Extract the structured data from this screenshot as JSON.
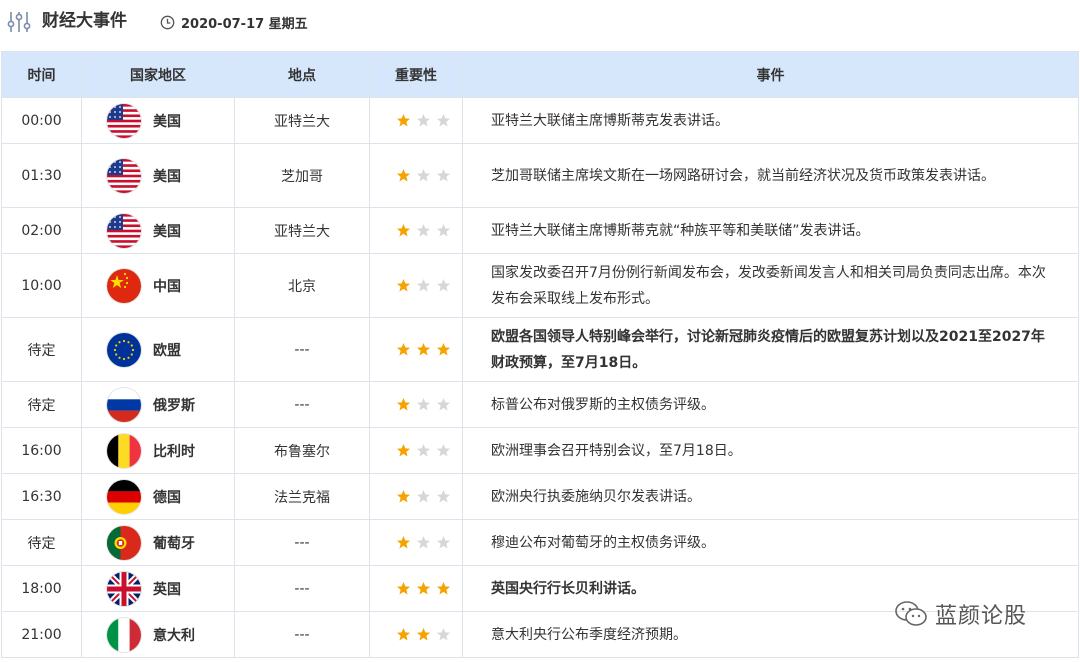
{
  "header": {
    "title": "财经大事件",
    "date": "2020-07-17 星期五",
    "icons": {
      "title_icon": "sliders-icon",
      "date_icon": "clock-icon"
    }
  },
  "table": {
    "columns": [
      "时间",
      "国家地区",
      "地点",
      "重要性",
      "事件"
    ],
    "rows": [
      {
        "time": "00:00",
        "country": "美国",
        "flag": "us",
        "location": "亚特兰大",
        "importance": 1,
        "event": "亚特兰大联储主席博斯蒂克发表讲话。",
        "important": false
      },
      {
        "time": "01:30",
        "country": "美国",
        "flag": "us",
        "location": "芝加哥",
        "importance": 1,
        "event": "芝加哥联储主席埃文斯在一场网路研讨会，就当前经济状况及货币政策发表讲话。",
        "important": false
      },
      {
        "time": "02:00",
        "country": "美国",
        "flag": "us",
        "location": "亚特兰大",
        "importance": 1,
        "event": "亚特兰大联储主席博斯蒂克就“种族平等和美联储”发表讲话。",
        "important": false
      },
      {
        "time": "10:00",
        "country": "中国",
        "flag": "cn",
        "location": "北京",
        "importance": 1,
        "event": "国家发改委召开7月份例行新闻发布会，发改委新闻发言人和相关司局负责同志出席。本次发布会采取线上发布形式。",
        "important": false
      },
      {
        "time": "待定",
        "country": "欧盟",
        "flag": "eu",
        "location": "---",
        "importance": 3,
        "event": "欧盟各国领导人特别峰会举行，讨论新冠肺炎疫情后的欧盟复苏计划以及2021至2027年财政预算，至7月18日。",
        "important": true
      },
      {
        "time": "待定",
        "country": "俄罗斯",
        "flag": "ru",
        "location": "---",
        "importance": 1,
        "event": "标普公布对俄罗斯的主权债务评级。",
        "important": false
      },
      {
        "time": "16:00",
        "country": "比利时",
        "flag": "be",
        "location": "布鲁塞尔",
        "importance": 1,
        "event": "欧洲理事会召开特别会议，至7月18日。",
        "important": false
      },
      {
        "time": "16:30",
        "country": "德国",
        "flag": "de",
        "location": "法兰克福",
        "importance": 1,
        "event": "欧洲央行执委施纳贝尔发表讲话。",
        "important": false
      },
      {
        "time": "待定",
        "country": "葡萄牙",
        "flag": "pt",
        "location": "---",
        "importance": 1,
        "event": "穆迪公布对葡萄牙的主权债务评级。",
        "important": false
      },
      {
        "time": "18:00",
        "country": "英国",
        "flag": "gb",
        "location": "---",
        "importance": 3,
        "event": "英国央行行长贝利讲话。",
        "important": true
      },
      {
        "time": "21:00",
        "country": "意大利",
        "flag": "it",
        "location": "---",
        "importance": 2,
        "event": "意大利央行公布季度经济预期。",
        "important": false
      }
    ],
    "max_importance": 3
  },
  "colors": {
    "header_bg": "#d6e7fb",
    "star_on": "#f5a300",
    "star_off": "#d7d7d7",
    "important_text": "#d9251c"
  },
  "watermark": {
    "text": "蓝颜论股",
    "icon": "wechat-icon"
  }
}
